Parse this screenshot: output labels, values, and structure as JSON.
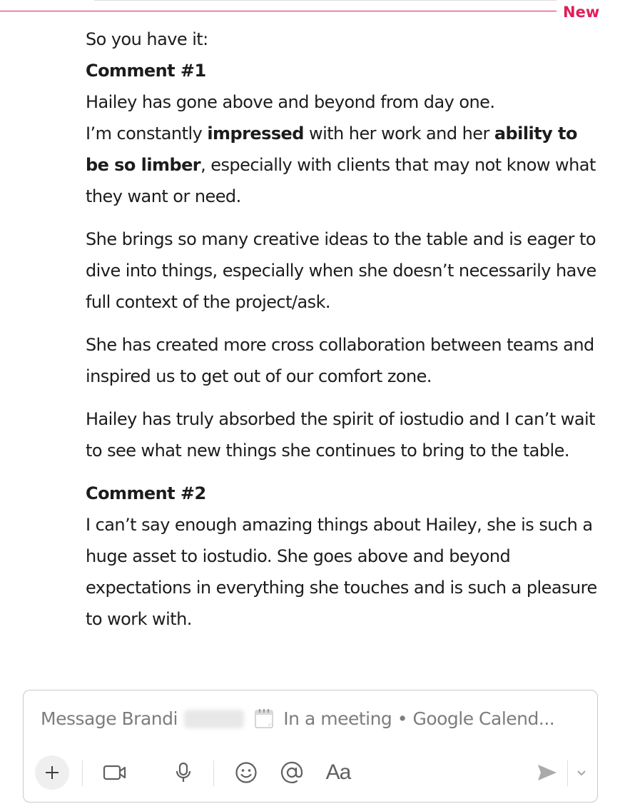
{
  "divider": {
    "label": "New"
  },
  "message": {
    "intro": "So you have it:",
    "comment1_heading": "Comment #1",
    "c1_line1": "Hailey has gone above and beyond from day one.",
    "c1_l2a": "I’m constantly ",
    "c1_l2b": "impressed",
    "c1_l2c": " with her work and her ",
    "c1_l2d": "ability to be so limber",
    "c1_l2e": ", especially with clients that may not know what they want or need.",
    "c1_p2": "She brings so many creative ideas to the table and is eager to dive into things, especially when she doesn’t necessarily have full context of the project/ask.",
    "c1_p3": "She has created more cross collaboration between teams and inspired us to get out of our comfort zone.",
    "c1_p4": "Hailey has truly absorbed the spirit of iostudio and I can’t wait to see what new things she continues to bring to the table.",
    "comment2_heading": "Comment #2",
    "c2_p1": "I can’t say enough amazing things about Hailey, she is such a huge asset to iostudio. She goes above and beyond expectations in everything she touches and is such a pleasure to work with."
  },
  "composer": {
    "placeholder_prefix": "Message Brandi",
    "status_text": "In a meeting • Google Calend...",
    "format_label": "Aa"
  },
  "icons": {
    "plus": "plus-icon",
    "video": "video-icon",
    "mic": "microphone-icon",
    "emoji": "emoji-icon",
    "mention": "mention-icon",
    "send": "send-icon",
    "chevron": "chevron-down-icon",
    "calendar": "calendar-icon"
  },
  "colors": {
    "new_accent": "#e01e5a",
    "text": "#1d1c1d",
    "muted": "#616061"
  }
}
